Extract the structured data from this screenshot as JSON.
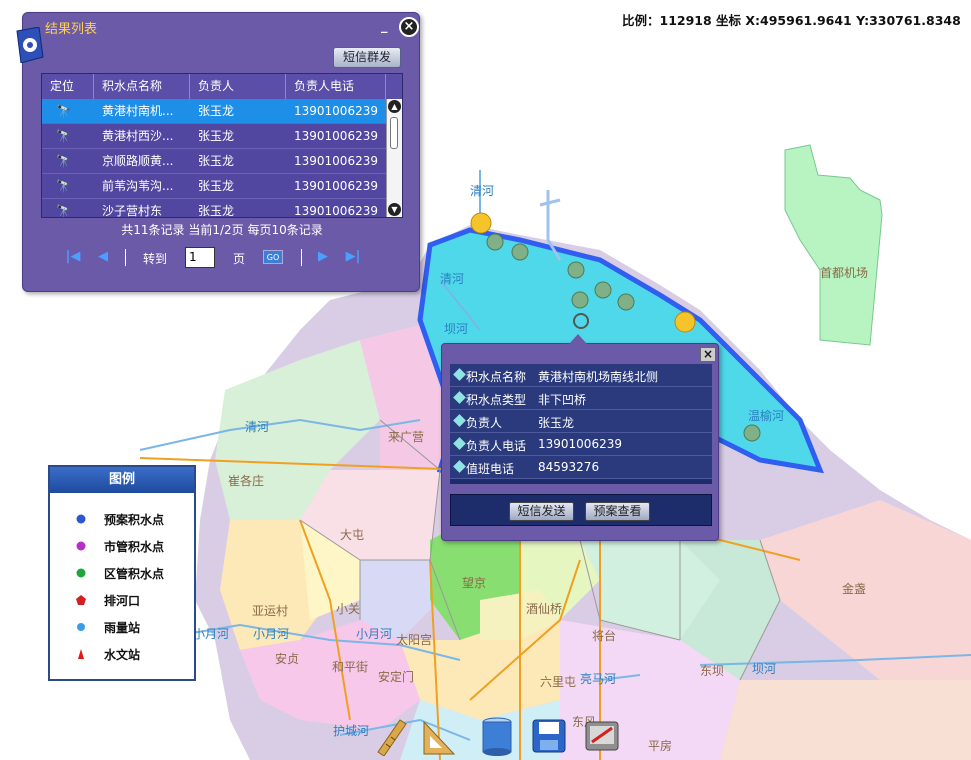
{
  "status": {
    "scale_coords": "比例：112918 坐标 X:495961.9641 Y:330761.8348"
  },
  "result_panel": {
    "title": "结果列表",
    "minimize": "_",
    "close": "×",
    "sms_mass_button": "短信群发",
    "columns": [
      "定位",
      "积水点名称",
      "负责人",
      "负责人电话"
    ],
    "rows": [
      {
        "name": "黄港村南机...",
        "person": "张玉龙",
        "phone": "13901006239",
        "selected": true
      },
      {
        "name": "黄港村西沙...",
        "person": "张玉龙",
        "phone": "13901006239"
      },
      {
        "name": "京顺路顺黄...",
        "person": "张玉龙",
        "phone": "13901006239"
      },
      {
        "name": "前苇沟苇沟...",
        "person": "张玉龙",
        "phone": "13901006239"
      },
      {
        "name": "沙子营村东",
        "person": "张玉龙",
        "phone": "13901006239"
      }
    ],
    "summary": "共11条记录  当前1/2页  每页10条记录",
    "pager": {
      "goto_label": "转到",
      "page_value": "1",
      "page_unit": "页",
      "go": "GO"
    }
  },
  "popup": {
    "close": "×",
    "fields": [
      {
        "key": "积水点名称",
        "value": "黄港村南机场南线北侧"
      },
      {
        "key": "积水点类型",
        "value": "非下凹桥"
      },
      {
        "key": "负责人",
        "value": "张玉龙"
      },
      {
        "key": "负责人电话",
        "value": "13901006239"
      },
      {
        "key": "值班电话",
        "value": "84593276"
      }
    ],
    "btn_sms": "短信发送",
    "btn_plan": "预案查看"
  },
  "legend": {
    "title": "图例",
    "items": [
      {
        "label": "预案积水点",
        "icon": "blue-dot-icon",
        "color": "#2f55d4"
      },
      {
        "label": "市管积水点",
        "icon": "purple-dot-icon",
        "color": "#b530c8"
      },
      {
        "label": "区管积水点",
        "icon": "green-dot-icon",
        "color": "#1da63a"
      },
      {
        "label": "排河口",
        "icon": "red-pentagon-icon",
        "color": "#d42020"
      },
      {
        "label": "雨量站",
        "icon": "light-blue-dot-icon",
        "color": "#3a9de8"
      },
      {
        "label": "水文站",
        "icon": "red-triangle-icon",
        "color": "#e01818"
      }
    ]
  },
  "map_labels": [
    "来广营",
    "崔各庄",
    "大屯",
    "小关",
    "太阳宫",
    "安贞",
    "和平街",
    "望京",
    "酒仙桥",
    "将台",
    "东坝",
    "首都机场",
    "金盏",
    "平房",
    "东风",
    "亚运村",
    "安定门",
    "六里屯"
  ],
  "river_labels": [
    "清河",
    "清河",
    "温榆河",
    "坝河",
    "小月河",
    "小月河",
    "小月河",
    "清河",
    "亮马河",
    "坝河",
    "护城河"
  ]
}
